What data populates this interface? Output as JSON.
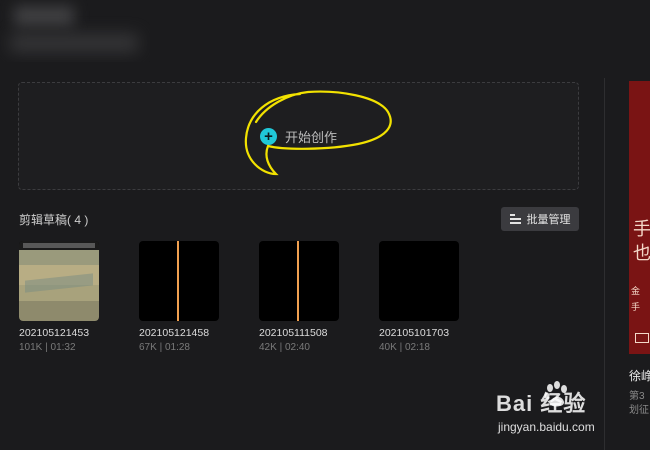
{
  "create": {
    "label": "开始创作",
    "icon": "plus-icon"
  },
  "drafts": {
    "title": "剪辑草稿( 4 )",
    "batch_button": "批量管理",
    "items": [
      {
        "name": "202105121453",
        "meta": "101K | 01:32",
        "thumb": "landscape"
      },
      {
        "name": "202105121458",
        "meta": "67K | 01:28",
        "thumb": "black-with-line"
      },
      {
        "name": "202105111508",
        "meta": "42K | 02:40",
        "thumb": "black-with-line"
      },
      {
        "name": "202105101703",
        "meta": "40K | 02:18",
        "thumb": "black"
      }
    ]
  },
  "right_panel": {
    "glyph_line1": "手",
    "glyph_line2": "也",
    "small_line1": "金",
    "small_line2": "手",
    "title_snippet": "徐峥",
    "sub_line1": "第3",
    "sub_line2": "划征"
  },
  "watermark": {
    "main": "Bai  经验",
    "sub": "jingyan.baidu.com"
  },
  "colors": {
    "accent": "#20c8d8",
    "background": "#1b1b1d",
    "annotation": "#f2e200",
    "playhead": "#f0a050"
  }
}
